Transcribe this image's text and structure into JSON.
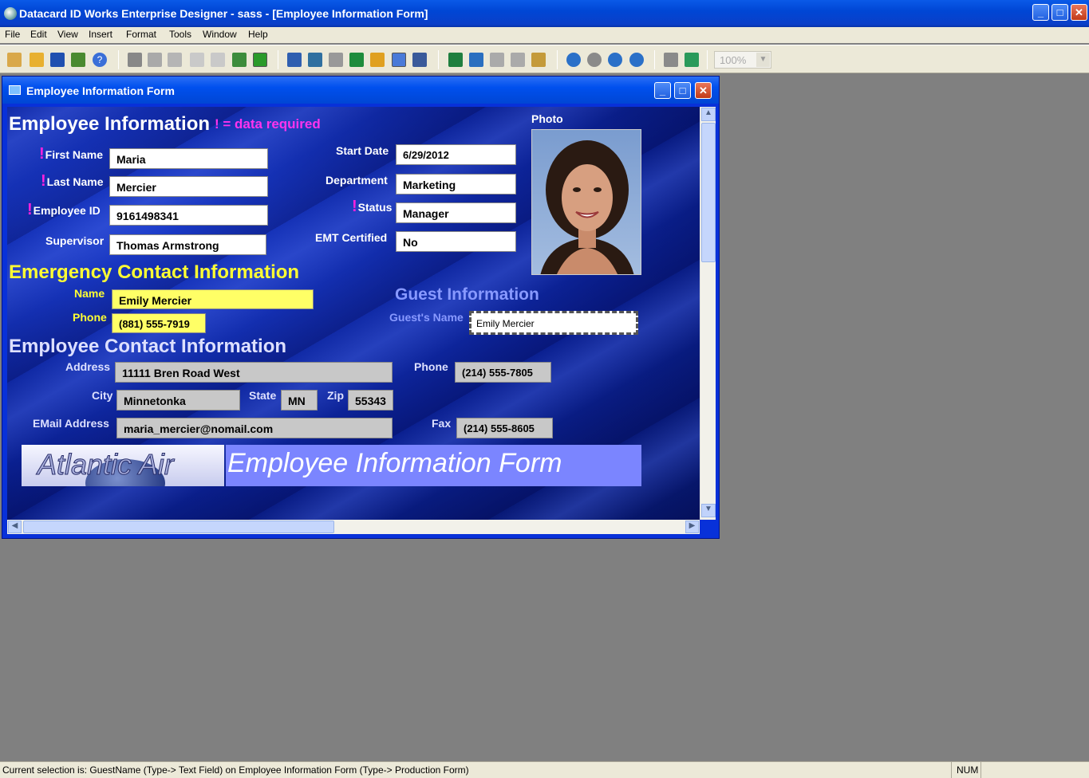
{
  "app": {
    "title": "Datacard ID Works Enterprise Designer - sass - [Employee Information Form]"
  },
  "menu": [
    "File",
    "Edit",
    "View",
    "Insert",
    "Format",
    "Tools",
    "Window",
    "Help"
  ],
  "toolbar": {
    "zoom": "100%"
  },
  "window": {
    "title": "Employee Information Form"
  },
  "form": {
    "heading": "Employee Information",
    "required_note": "! = data required",
    "required_mark": "!",
    "first_name_label": "First Name",
    "first_name": "Maria",
    "last_name_label": "Last Name",
    "last_name": "Mercier",
    "employee_id_label": "Employee ID",
    "employee_id": "9161498341",
    "supervisor_label": "Supervisor",
    "supervisor": "Thomas Armstrong",
    "start_date_label": "Start Date",
    "start_date": "6/29/2012",
    "department_label": "Department",
    "department": "Marketing",
    "status_label": "Status",
    "status": "Manager",
    "emt_label": "EMT Certified",
    "emt": "No",
    "photo_label": "Photo",
    "emergency_heading": "Emergency Contact Information",
    "em_name_label": "Name",
    "em_name": "Emily Mercier",
    "em_phone_label": "Phone",
    "em_phone": "(881) 555-7919",
    "guest_heading": "Guest Information",
    "guest_name_label": "Guest's Name",
    "guest_name": "Emily Mercier",
    "contact_heading": "Employee Contact Information",
    "address_label": "Address",
    "address": "11111 Bren Road West",
    "phone_label": "Phone",
    "phone": "(214) 555-7805",
    "city_label": "City",
    "city": "Minnetonka",
    "state_label": "State",
    "state": "MN",
    "zip_label": "Zip",
    "zip": "55343",
    "email_label": "EMail Address",
    "email": "maria_mercier@nomail.com",
    "fax_label": "Fax",
    "fax": "(214) 555-8605",
    "logo_text": "Atlantic Air",
    "banner": "Employee Information Form"
  },
  "status": {
    "message": "Current selection is: GuestName (Type-> Text Field) on Employee Information Form (Type-> Production Form)",
    "num": "NUM"
  }
}
